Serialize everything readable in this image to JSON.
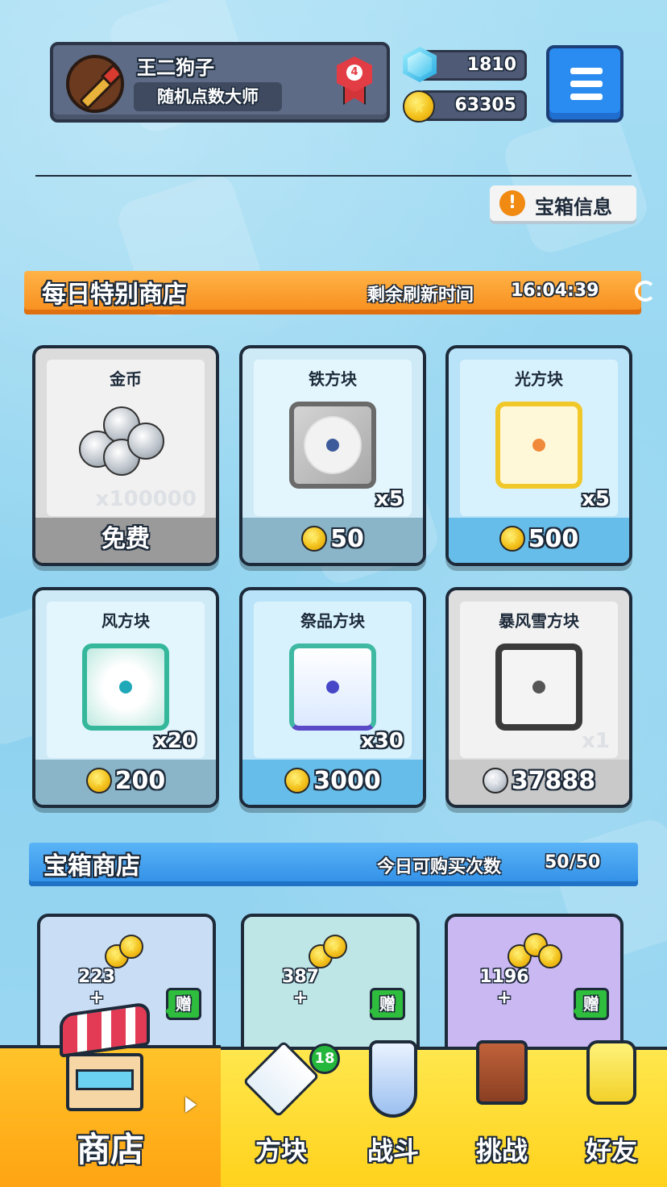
{
  "header": {
    "player_name": "王二狗子",
    "player_title": "随机点数大师",
    "rank_level": "4",
    "gems": "1810",
    "coins": "63305",
    "chest_info_label": "宝箱信息"
  },
  "daily_shop": {
    "title": "每日特别商店",
    "refresh_label": "剩余刷新时间",
    "refresh_time": "16:04:39",
    "items": [
      {
        "name": "金币",
        "qty": "x100000",
        "price": "免费",
        "currency": "none"
      },
      {
        "name": "铁方块",
        "qty": "x5",
        "price": "50",
        "currency": "gold"
      },
      {
        "name": "光方块",
        "qty": "x5",
        "price": "500",
        "currency": "gold"
      },
      {
        "name": "风方块",
        "qty": "x20",
        "price": "200",
        "currency": "gold"
      },
      {
        "name": "祭品方块",
        "qty": "x30",
        "price": "3000",
        "currency": "gold"
      },
      {
        "name": "暴风雪方块",
        "qty": "x1",
        "price": "37888",
        "currency": "silver"
      }
    ]
  },
  "chest_shop": {
    "title": "宝箱商店",
    "purchases_label": "今日可购买次数",
    "purchases_value": "50/50",
    "chests": [
      {
        "coins": "223",
        "plus": "+",
        "gift": "赠"
      },
      {
        "coins": "387",
        "plus": "+",
        "gift": "赠"
      },
      {
        "coins": "1196",
        "plus": "+",
        "gift": "赠"
      }
    ]
  },
  "nav": {
    "shop": "商店",
    "blocks": "方块",
    "blocks_badge": "18",
    "battle": "战斗",
    "challenge": "挑战",
    "friends": "好友"
  },
  "colors": {
    "daily_banner": "#f78d1c",
    "chest_banner": "#2f8ee6",
    "nav_active": "#ffa412",
    "nav": "#ffd21c"
  }
}
